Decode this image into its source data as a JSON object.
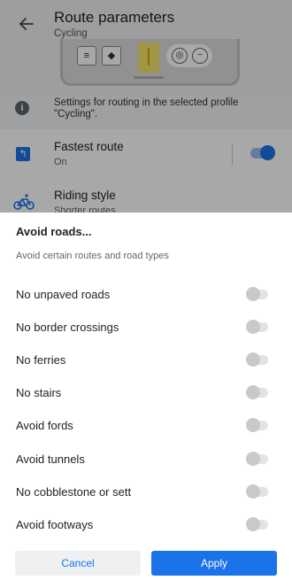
{
  "background": {
    "title": "Route parameters",
    "subtitle": "Cycling",
    "info_text": "Settings for routing in the selected profile \"Cycling\".",
    "fastest_route": {
      "title": "Fastest route",
      "value": "On",
      "enabled": true
    },
    "riding_style": {
      "title": "Riding style",
      "value": "Shorter routes"
    },
    "icons": [
      "back-arrow-icon",
      "info-icon",
      "route-icon",
      "bicycle-icon"
    ],
    "accent_color": "#1a73e8"
  },
  "sheet": {
    "title": "Avoid roads...",
    "description": "Avoid certain routes and road types",
    "options": [
      {
        "label": "No unpaved roads",
        "enabled": false
      },
      {
        "label": "No border crossings",
        "enabled": false
      },
      {
        "label": "No ferries",
        "enabled": false
      },
      {
        "label": "No stairs",
        "enabled": false
      },
      {
        "label": "Avoid fords",
        "enabled": false
      },
      {
        "label": "Avoid tunnels",
        "enabled": false
      },
      {
        "label": "No cobblestone or sett",
        "enabled": false
      },
      {
        "label": "Avoid footways",
        "enabled": false
      }
    ],
    "cancel_label": "Cancel",
    "apply_label": "Apply"
  }
}
